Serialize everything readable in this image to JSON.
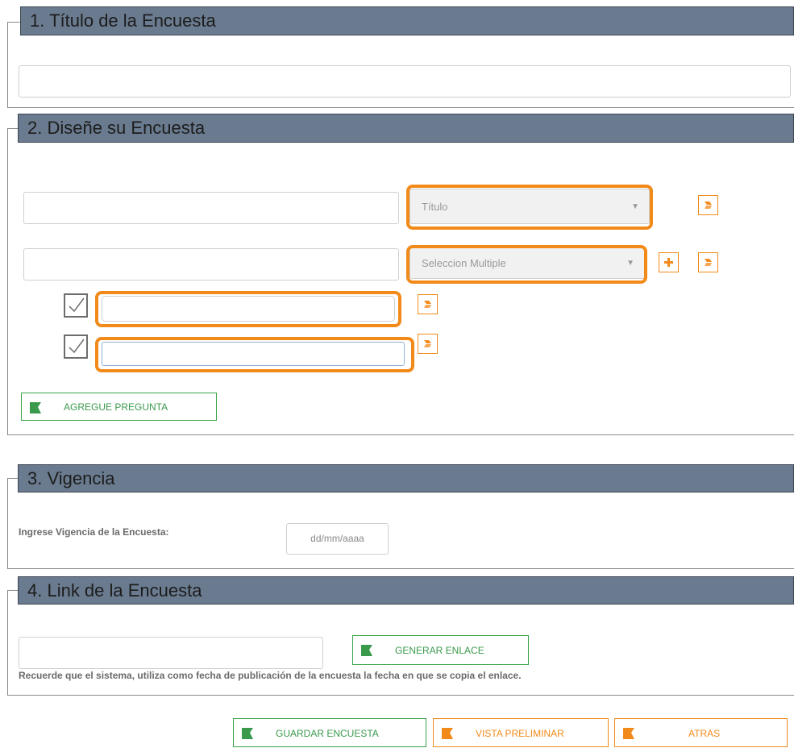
{
  "sections": {
    "title": {
      "heading": "1. Título de la Encuesta",
      "input_value": ""
    },
    "design": {
      "heading": "2. Diseñe su Encuesta",
      "questions": [
        {
          "text": "",
          "type": "Título"
        },
        {
          "text": "",
          "type": "Seleccion Multiple"
        }
      ],
      "options": [
        "",
        ""
      ],
      "add_question_label": "AGREGUE PREGUNTA"
    },
    "validity": {
      "heading": "3. Vigencia",
      "label": "Ingrese Vigencia de la Encuesta:",
      "date_placeholder": "dd/mm/aaaa"
    },
    "link": {
      "heading": "4. Link de la Encuesta",
      "input_value": "",
      "generate_label": "GENERAR ENLACE",
      "note": "Recuerde que el sistema, utiliza como fecha de publicación de la encuesta la fecha en que se copia el enlace."
    }
  },
  "actions": {
    "save_label": "GUARDAR ENCUESTA",
    "preview_label": "VISTA PRELIMINAR",
    "back_label": "ATRAS"
  },
  "colors": {
    "header_bg": "#6a7b8f",
    "highlight": "#f28a1a",
    "green": "#3aa44a",
    "orange": "#f28a1a"
  },
  "icons": {
    "delete": "eraser-icon",
    "add": "plus-icon",
    "check": "checkmark-icon",
    "flag": "flag-icon"
  }
}
